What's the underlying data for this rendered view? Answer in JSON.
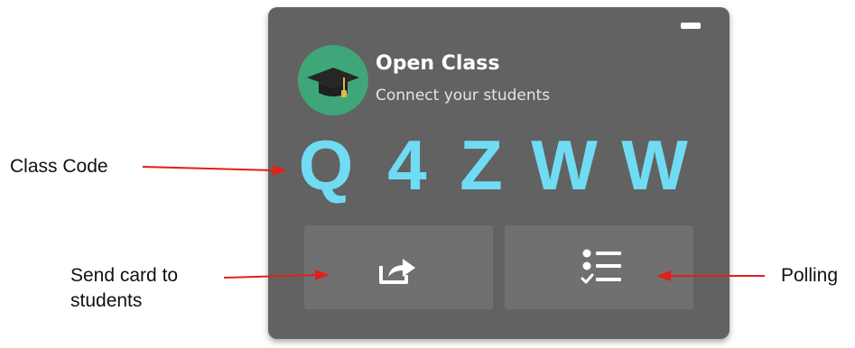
{
  "panel": {
    "title": "Open Class",
    "subtitle": "Connect your students",
    "class_code": [
      "Q",
      "4",
      "Z",
      "W",
      "W"
    ]
  },
  "annotations": {
    "class_code": "Class Code",
    "send_card_line1": "Send card to",
    "send_card_line2": "students",
    "polling": "Polling"
  },
  "icons": {
    "avatar": "graduation-cap-icon",
    "send": "share-icon",
    "polling": "checklist-icon",
    "minimize": "minimize-icon"
  },
  "colors": {
    "panel_bg": "#626262",
    "tile_bg": "#707070",
    "code_color": "#6fdcf4",
    "avatar_bg": "#3fa679",
    "arrow_color": "#e0201a"
  }
}
